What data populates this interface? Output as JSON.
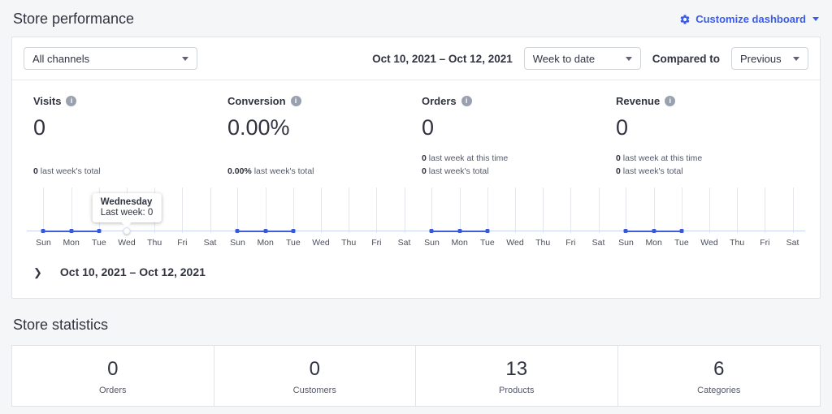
{
  "header": {
    "title": "Store performance",
    "customize_label": "Customize dashboard"
  },
  "filters": {
    "channel_select": "All channels",
    "date_range": "Oct 10, 2021 – Oct 12, 2021",
    "period_select": "Week to date",
    "compared_to_label": "Compared to",
    "comparison_select": "Previous"
  },
  "metrics": [
    {
      "label": "Visits",
      "value": "0",
      "sublines": [
        {
          "value": "0",
          "text": "last week's total"
        }
      ]
    },
    {
      "label": "Conversion",
      "value": "0.00%",
      "sublines": [
        {
          "value": "0.00%",
          "text": "last week's total"
        }
      ]
    },
    {
      "label": "Orders",
      "value": "0",
      "sublines": [
        {
          "value": "0",
          "text": "last week at this time"
        },
        {
          "value": "0",
          "text": "last week's total"
        }
      ]
    },
    {
      "label": "Revenue",
      "value": "0",
      "sublines": [
        {
          "value": "0",
          "text": "last week at this time"
        },
        {
          "value": "0",
          "text": "last week's total"
        }
      ]
    }
  ],
  "tooltip": {
    "title": "Wednesday",
    "text": "Last week: 0"
  },
  "expand_row": {
    "label": "Oct 10, 2021 – Oct 12, 2021"
  },
  "statistics": {
    "title": "Store statistics",
    "items": [
      {
        "value": "0",
        "label": "Orders"
      },
      {
        "value": "0",
        "label": "Customers"
      },
      {
        "value": "13",
        "label": "Products"
      },
      {
        "value": "6",
        "label": "Categories"
      }
    ]
  },
  "chart_data": {
    "type": "line",
    "categories": [
      "Sun",
      "Mon",
      "Tue",
      "Wed",
      "Thu",
      "Fri",
      "Sat"
    ],
    "series": [
      {
        "name": "Visits",
        "values": [
          0,
          0,
          0,
          null,
          null,
          null,
          null
        ]
      },
      {
        "name": "Conversion",
        "values": [
          0,
          0,
          0,
          null,
          null,
          null,
          null
        ]
      },
      {
        "name": "Orders",
        "values": [
          0,
          0,
          0,
          null,
          null,
          null,
          null
        ]
      },
      {
        "name": "Revenue",
        "values": [
          0,
          0,
          0,
          null,
          null,
          null,
          null
        ]
      }
    ],
    "annotations": [
      {
        "series": "Visits",
        "x": "Wed",
        "title": "Wednesday",
        "text": "Last week: 0"
      }
    ],
    "legend": false,
    "grid": "vertical-day-lines",
    "ylim": [
      0,
      1
    ]
  },
  "colors": {
    "accent_blue": "#3A5CE9",
    "spark_line": "#3F5FD9",
    "spark_baseline": "#C9D4F0",
    "gridline": "#E4E7EB",
    "text_primary": "#313440",
    "text_secondary": "#54596B",
    "page_bg": "#F5F6F7",
    "panel_border": "#E0E3E8"
  }
}
